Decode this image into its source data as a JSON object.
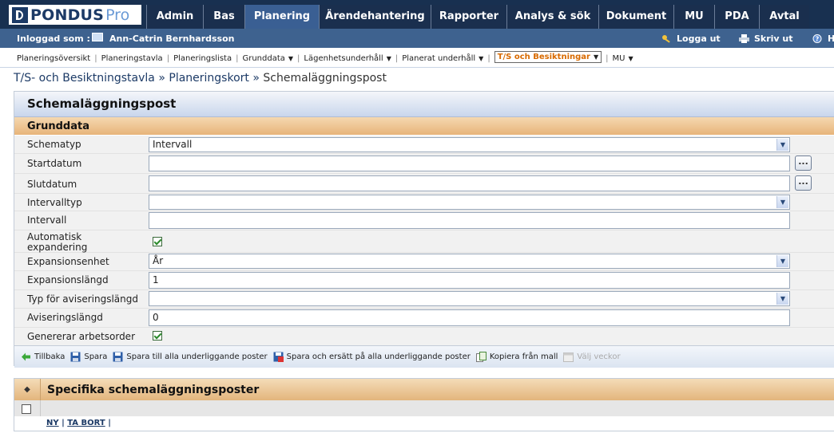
{
  "app": {
    "logo_text": "PONDUS",
    "logo_pro": "Pro"
  },
  "tabs": [
    {
      "label": "Admin",
      "active": false
    },
    {
      "label": "Bas",
      "active": false
    },
    {
      "label": "Planering",
      "active": true
    },
    {
      "label": "Ärendehantering",
      "active": false
    },
    {
      "label": "Rapporter",
      "active": false
    },
    {
      "label": "Analys & sök",
      "active": false
    },
    {
      "label": "Dokument",
      "active": false
    },
    {
      "label": "MU",
      "active": false
    },
    {
      "label": "PDA",
      "active": false
    },
    {
      "label": "Avtal",
      "active": false
    }
  ],
  "userbar": {
    "logged_in_label": "Inloggad som :",
    "user_name": "Ann-Catrin Bernhardsson",
    "logout": "Logga ut",
    "print": "Skriv ut",
    "help": "H"
  },
  "subnav": [
    {
      "label": "Planeringsöversikt",
      "dropdown": false
    },
    {
      "label": "Planeringstavla",
      "dropdown": false
    },
    {
      "label": "Planeringslista",
      "dropdown": false
    },
    {
      "label": "Grunddata",
      "dropdown": true
    },
    {
      "label": "Lägenhetsunderhåll",
      "dropdown": true
    },
    {
      "label": "Planerat underhåll",
      "dropdown": true
    },
    {
      "label": "T/S och Besiktningar",
      "dropdown": true,
      "selected": true
    },
    {
      "label": "MU",
      "dropdown": true
    }
  ],
  "breadcrumb": {
    "link1": "T/S- och Besiktningstavla",
    "sep": "»",
    "link2": "Planeringskort",
    "current": "Schemaläggningspost"
  },
  "panel": {
    "title": "Schemaläggningspost",
    "section": "Grunddata",
    "fields": {
      "schematyp": {
        "label": "Schematyp",
        "value": "Intervall"
      },
      "startdatum": {
        "label": "Startdatum",
        "value": ""
      },
      "slutdatum": {
        "label": "Slutdatum",
        "value": ""
      },
      "intervalltyp": {
        "label": "Intervalltyp",
        "value": ""
      },
      "intervall": {
        "label": "Intervall",
        "value": ""
      },
      "automatisk_line1": "Automatisk",
      "automatisk_line2": "expandering",
      "expansionsenhet": {
        "label": "Expansionsenhet",
        "value": "År"
      },
      "expansionslangd": {
        "label": "Expansionslängd",
        "value": "1"
      },
      "typ_avisering": {
        "label": "Typ för aviseringslängd",
        "value": ""
      },
      "aviseringslangd": {
        "label": "Aviseringslängd",
        "value": "0"
      },
      "genererar": {
        "label": "Genererar arbetsorder"
      }
    },
    "date_button": "..."
  },
  "actions": {
    "back": "Tillbaka",
    "save": "Spara",
    "save_all": "Spara till alla underliggande poster",
    "save_replace": "Spara och ersätt på alla underliggande poster",
    "copy_template": "Kopiera från mall",
    "choose_weeks": "Välj veckor"
  },
  "grid": {
    "sort_icon": "◆",
    "title": "Specifika schemaläggningsposter",
    "link_new": "NY",
    "link_delete": "TA BORT",
    "sep": "|"
  },
  "colors": {
    "topbar": "#183050",
    "active_tab": "#3a5f93",
    "userbar": "#3e628f",
    "section_orange": "#e7b47a",
    "selected_subnav": "#d86a00"
  }
}
